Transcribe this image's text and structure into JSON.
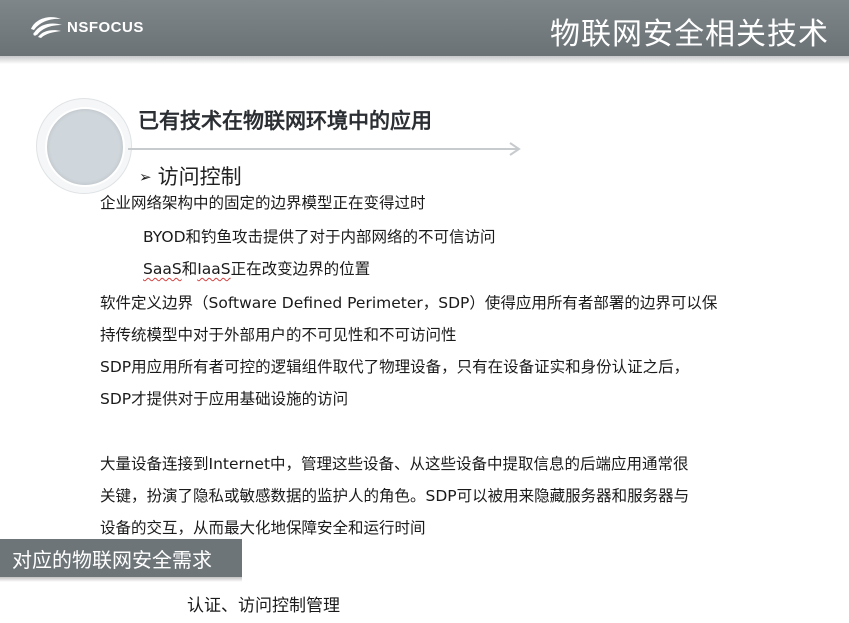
{
  "header": {
    "logo_text": "NSFOCUS",
    "title": "物联网安全相关技术"
  },
  "section": {
    "heading": "已有技术在物联网环境中的应用",
    "bullet_marker": "➢",
    "bullet_label": "访问控制"
  },
  "body": {
    "line1": "企业网络架构中的固定的边界模型正在变得过时",
    "line2": "BYOD和钓鱼攻击提供了对于内部网络的不可信访问",
    "line3_a": "SaaS",
    "line3_b": "和",
    "line3_c": "IaaS",
    "line3_d": "正在改变边界的位置",
    "line4": "软件定义边界（Software Defined Perimeter，SDP）使得应用所有者部署的边界可以保",
    "line5": "持传统模型中对于外部用户的不可见性和不可访问性",
    "line6": "SDP用应用所有者可控的逻辑组件取代了物理设备，只有在设备证实和身份认证之后，",
    "line7": "SDP才提供对于应用基础设施的访问",
    "line8": "大量设备连接到Internet中，管理这些设备、从这些设备中提取信息的后端应用通常很",
    "line9": "关键，扮演了隐私或敏感数据的监护人的角色。SDP可以被用来隐藏服务器和服务器与",
    "line10": "设备的交互，从而最大化地保障安全和运行时间"
  },
  "requirements": {
    "banner": "对应的物联网安全需求",
    "item": "认证、访问控制管理"
  }
}
